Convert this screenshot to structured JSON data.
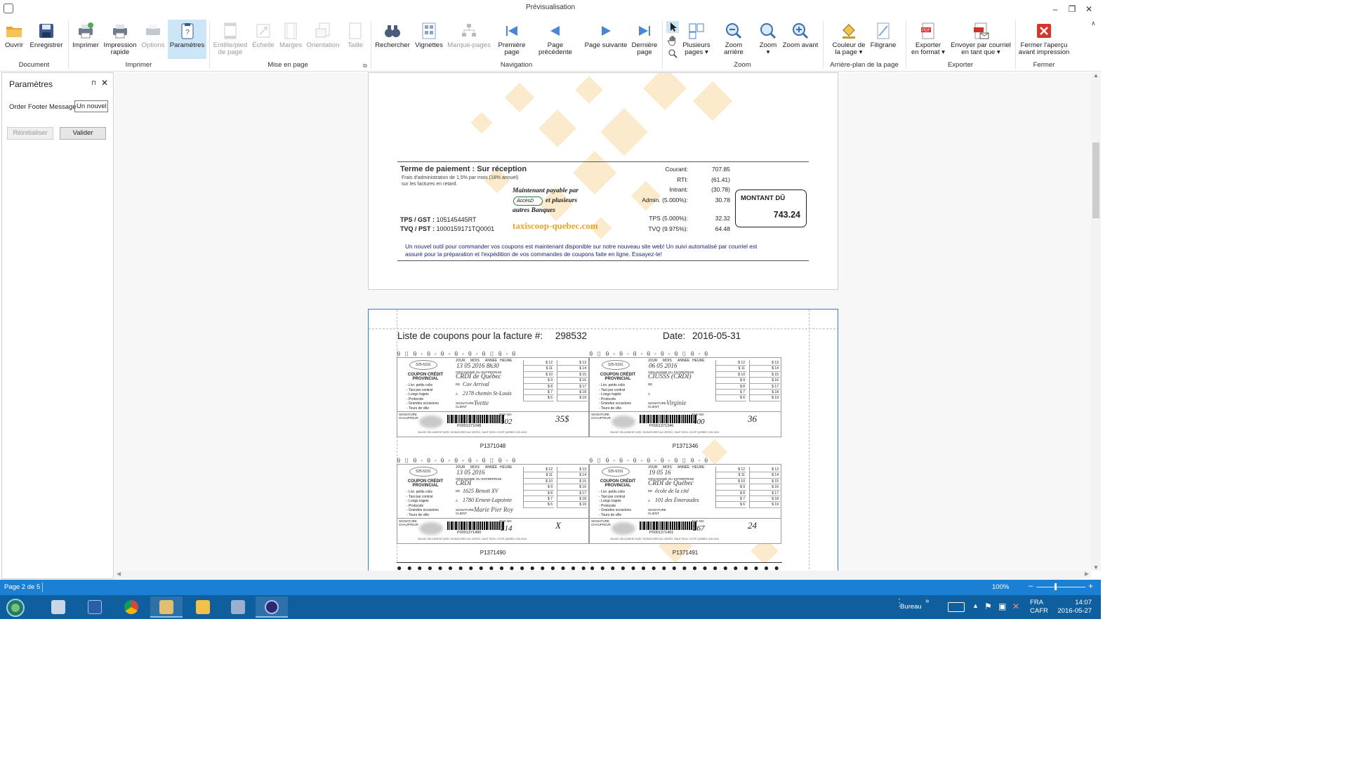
{
  "window": {
    "title": "Prévisualisation",
    "minimize": "–",
    "restore": "❐",
    "close": "✕"
  },
  "ribbon": {
    "groups": {
      "document": "Document",
      "imprimer": "Imprimer",
      "mise_en_page": "Mise en page",
      "navigation": "Navigation",
      "zoom": "Zoom",
      "arriere_plan": "Arrière-plan de la page",
      "exporter": "Exporter",
      "fermer": "Fermer"
    },
    "buttons": {
      "ouvrir": "Ouvrir",
      "enregistrer": "Enregistrer",
      "imprimer": "Imprimer",
      "impression_rapide_1": "Impression",
      "impression_rapide_2": "rapide",
      "options": "Options",
      "parametres": "Paramètres",
      "entete_1": "Entête/pied",
      "entete_2": "de page",
      "echelle": "Échelle",
      "marges": "Marges",
      "orientation": "Orientation",
      "taille": "Taille",
      "rechercher": "Rechercher",
      "vignettes": "Vignettes",
      "marque_pages": "Marque-pages",
      "premiere_1": "Première",
      "premiere_2": "page",
      "precedente": "Page précédente",
      "suivante": "Page suivante",
      "derniere_1": "Dernière",
      "derniere_2": "page",
      "plusieurs_1": "Plusieurs",
      "plusieurs_2": "pages",
      "zoom_arriere": "Zoom arrière",
      "zoom": "Zoom",
      "zoom_avant": "Zoom avant",
      "couleur_1": "Couleur de",
      "couleur_2": "la page",
      "filigrane": "Filigrane",
      "exporter_1": "Exporter",
      "exporter_2": "en format",
      "envoyer_1": "Envoyer par courriel",
      "envoyer_2": "en tant que",
      "fermer_1": "Fermer l'aperçu",
      "fermer_2": "avant impression"
    }
  },
  "parameters_panel": {
    "title": "Paramètres",
    "pin": "⊓",
    "close": "✕",
    "field_label": "Order Footer Message",
    "field_value": "Un nouvel",
    "reset": "Réinitialiser",
    "submit": "Valider"
  },
  "invoice_page": {
    "payment_terms": "Terme de paiement : Sur réception",
    "admin_fee_1": "Frais d'administration de 1,5% par mois (18% annuel)",
    "admin_fee_2": "sur les factures en retard.",
    "payable_1": "Maintenant payable par",
    "accesd": "AccèsD",
    "payable_2": "et plusieurs",
    "payable_3": "autres Banques",
    "tps_label": "TPS / GST :",
    "tps_number": "105145445RT",
    "tvq_label": "TVQ / PST :",
    "tvq_number": "1000159171TQ0001",
    "website": "taxiscoop-quebec.com",
    "totals": [
      {
        "label": "Courant:",
        "value": "707.85"
      },
      {
        "label": "RTI:",
        "value": "(61.41)"
      },
      {
        "label": "Intrant:",
        "value": "(30.78)"
      },
      {
        "label": "Admin. (5.000%):",
        "value": "30.78"
      },
      {
        "label": "TPS (5.000%):",
        "value": "32.32"
      },
      {
        "label": "TVQ (9.975%):",
        "value": "64.48"
      }
    ],
    "amount_due_label": "MONTANT DÛ",
    "amount_due": "743.24",
    "footer_1": "Un nouvel outil pour commander vos coupons est maintenant disponible sur notre nouveau site web! Un suivi automatisé par courriel est",
    "footer_2": "assuré pour la préparation et l'expédition de vos commandes de coupons faite en ligne. Essayez-le!"
  },
  "coupons_page": {
    "list_label": "Liste de coupons pour la facture #:",
    "invoice_number": "298532",
    "date_label": "Date:",
    "date": "2016-05-31",
    "coupon_common": {
      "phone": "525-5191",
      "title_1": "COUPON CRÉDIT",
      "title_2": "PROVINCIAL",
      "services": [
        "- Livr. petits colis",
        "- Taxi par contrat",
        "- Longs trajets",
        "- Protocole",
        "- Grandes occasions",
        "- Tours de ville"
      ],
      "head_cols": [
        "JOUR",
        "MOIS",
        "ANNÉE",
        "HEURE"
      ],
      "org_label": "ORGANISME OU ENTREPRISE",
      "de_label": "DE",
      "a_label": "À",
      "signature_client": "SIGNATURE CLIENT",
      "signature_chauffeur": "SIGNATURE CHAUFFEUR",
      "taxi_label": "TAXI NO",
      "amounts_left": [
        "$ 12",
        "$ 11",
        "$ 10",
        "$ 9",
        "$ 8",
        "$ 7",
        "$ 6"
      ],
      "amounts_right": [
        "$ 13",
        "$ 14",
        "$ 15",
        "$ 16",
        "$ 17",
        "$ 18",
        "$ 19"
      ],
      "validity": "VALIDE SEULEMENT AVEC SIGNATURES AU VERSO, SAUF SIGN. COOP QUÉBEC 525-5191"
    },
    "coupons": [
      {
        "id": "P1371048",
        "barcode": "P0001371048",
        "date": "13 05 2016 8h30",
        "org": "CRDI de Québec",
        "de": "Cov Arrival",
        "a": "2178 chemin St-Louis",
        "sig": "Yvette",
        "taxi": "102",
        "amount": "35$"
      },
      {
        "id": "P1371346",
        "barcode": "P0001371346",
        "date": "06 05 2016",
        "org": "CIUSSS (CRDI)",
        "de": "",
        "a": "",
        "sig": "Virginie",
        "taxi": "400",
        "amount": "36"
      },
      {
        "id": "P1371490",
        "barcode": "P0001371490",
        "date": "13 05 2016",
        "org": "CRDI",
        "de": "1625 Benoit XV",
        "a": "1780 Ernest-Lapointe",
        "sig": "Marie Pier Roy",
        "taxi": "214",
        "amount": "X"
      },
      {
        "id": "P1371491",
        "barcode": "P0001371491",
        "date": "19 05 16",
        "org": "CRDI de Québec",
        "de": "école de la cité",
        "a": "101 des Émeraudes",
        "sig": "",
        "taxi": "267",
        "amount": "24"
      }
    ]
  },
  "status": {
    "page": "Page 2 de 5",
    "zoom": "100%",
    "zoom_minus": "–",
    "zoom_plus": "+"
  },
  "taskbar": {
    "apps": [
      "start-orb",
      "server-manager",
      "powershell",
      "chrome",
      "tools",
      "file-explorer",
      "network-app",
      "eclipse-app"
    ],
    "desktop_label": "Bureau",
    "lang_1": "FRA",
    "lang_2": "CAFR",
    "time": "14:07",
    "date": "2016-05-27"
  }
}
